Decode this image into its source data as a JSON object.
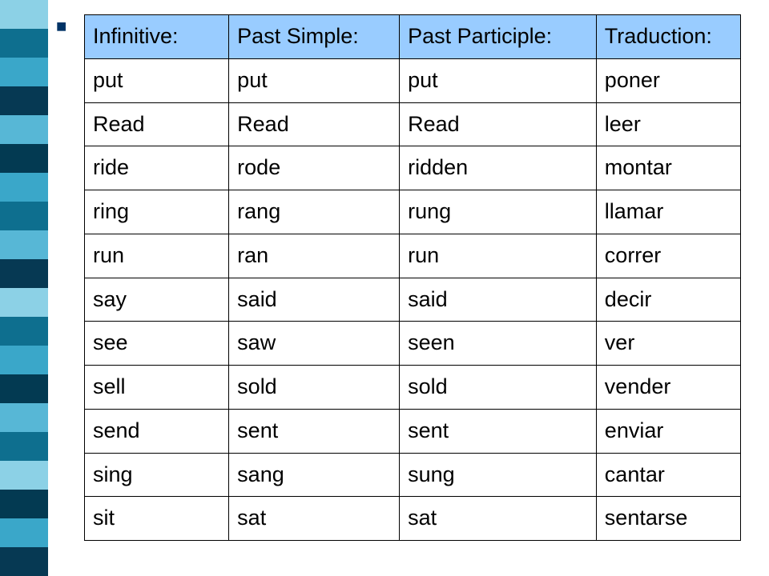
{
  "stripes": [
    "#8cd1e6",
    "#0e6f8f",
    "#3aa7c9",
    "#063953",
    "#57b7d6",
    "#033a52",
    "#3aa7c9",
    "#0e6f8f",
    "#57b7d6",
    "#063953",
    "#8cd1e6",
    "#0e6f8f",
    "#3aa7c9",
    "#033a52",
    "#57b7d6",
    "#0e6f8f",
    "#8cd1e6",
    "#033a52",
    "#3aa7c9",
    "#063953"
  ],
  "headers": {
    "infinitive": "Infinitive:",
    "past_simple": "Past Simple:",
    "past_participle": "Past Participle:",
    "traduction": "Traduction:"
  },
  "rows": [
    {
      "inf": "put",
      "ps": "put",
      "pp": "put",
      "tr": "poner"
    },
    {
      "inf": "Read",
      "ps": "Read",
      "pp": "Read",
      "tr": "leer"
    },
    {
      "inf": "ride",
      "ps": "rode",
      "pp": "ridden",
      "tr": "montar"
    },
    {
      "inf": "ring",
      "ps": "rang",
      "pp": "rung",
      "tr": "llamar"
    },
    {
      "inf": "run",
      "ps": "ran",
      "pp": "run",
      "tr": "correr"
    },
    {
      "inf": "say",
      "ps": "said",
      "pp": "said",
      "tr": "decir"
    },
    {
      "inf": "see",
      "ps": "saw",
      "pp": "seen",
      "tr": "ver"
    },
    {
      "inf": "sell",
      "ps": "sold",
      "pp": "sold",
      "tr": "vender"
    },
    {
      "inf": "send",
      "ps": "sent",
      "pp": "sent",
      "tr": "enviar"
    },
    {
      "inf": "sing",
      "ps": "sang",
      "pp": "sung",
      "tr": "cantar"
    },
    {
      "inf": "sit",
      "ps": "sat",
      "pp": "sat",
      "tr": "sentarse"
    }
  ],
  "bullet": "■"
}
